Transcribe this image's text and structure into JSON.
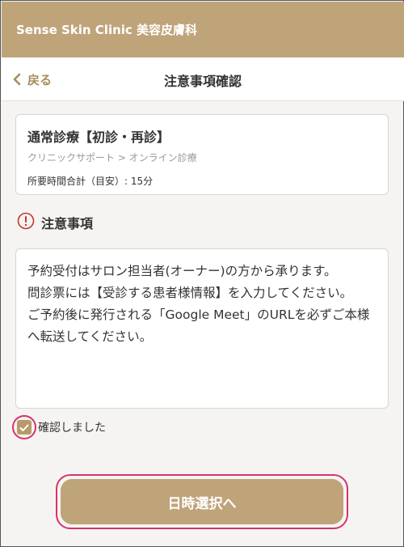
{
  "header": {
    "title": "Sense Skin Clinic 美容皮膚科"
  },
  "nav": {
    "back_label": "戻る",
    "title": "注意事項確認"
  },
  "course": {
    "name": "通常診療【初診・再診】",
    "path": "クリニックサポート > オンライン診療",
    "time": "所要時間合計（目安）: 15分"
  },
  "notice": {
    "title": "注意事項",
    "lines": [
      "予約受付はサロン担当者(オーナー)の方から承ります。",
      "問診票には【受診する患者様情報】を入力してください。",
      "ご予約後に発行される「Google Meet」のURLを必ずご本様へ転送してください。"
    ]
  },
  "confirm": {
    "label": "確認しました",
    "checked": true
  },
  "next_button": {
    "label": "日時選択へ"
  },
  "colors": {
    "brand": "#bfa47a",
    "accent_link": "#a88c5c",
    "highlight": "#d6336c",
    "alert": "#c0392b"
  }
}
